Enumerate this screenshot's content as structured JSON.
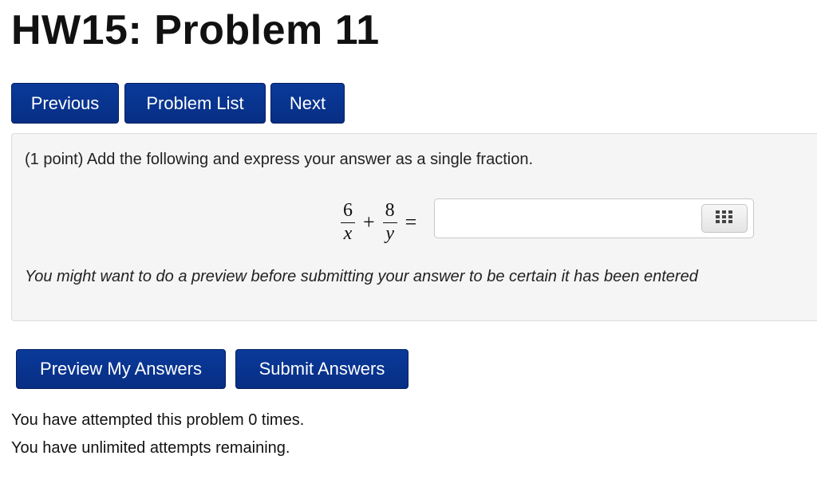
{
  "page": {
    "title": "HW15: Problem 11"
  },
  "nav": {
    "previous_label": "Previous",
    "problem_list_label": "Problem List",
    "next_label": "Next"
  },
  "problem": {
    "prompt": "(1 point) Add the following and express your answer as a single fraction.",
    "expression": {
      "term1_numerator": "6",
      "term1_denominator": "x",
      "operator": "+",
      "term2_numerator": "8",
      "term2_denominator": "y",
      "equals": "="
    },
    "answer_value": "",
    "answer_placeholder": "",
    "hint": "You might want to do a preview before submitting your answer to be certain it has been entered"
  },
  "actions": {
    "preview_label": "Preview My Answers",
    "submit_label": "Submit Answers"
  },
  "status": {
    "attempts_text": "You have attempted this problem 0 times.",
    "remaining_text": "You have unlimited attempts remaining."
  },
  "icons": {
    "equation_editor": "keypad-grid-icon"
  },
  "colors": {
    "button_bg": "#0a3a9a",
    "panel_bg": "#f5f5f5"
  }
}
